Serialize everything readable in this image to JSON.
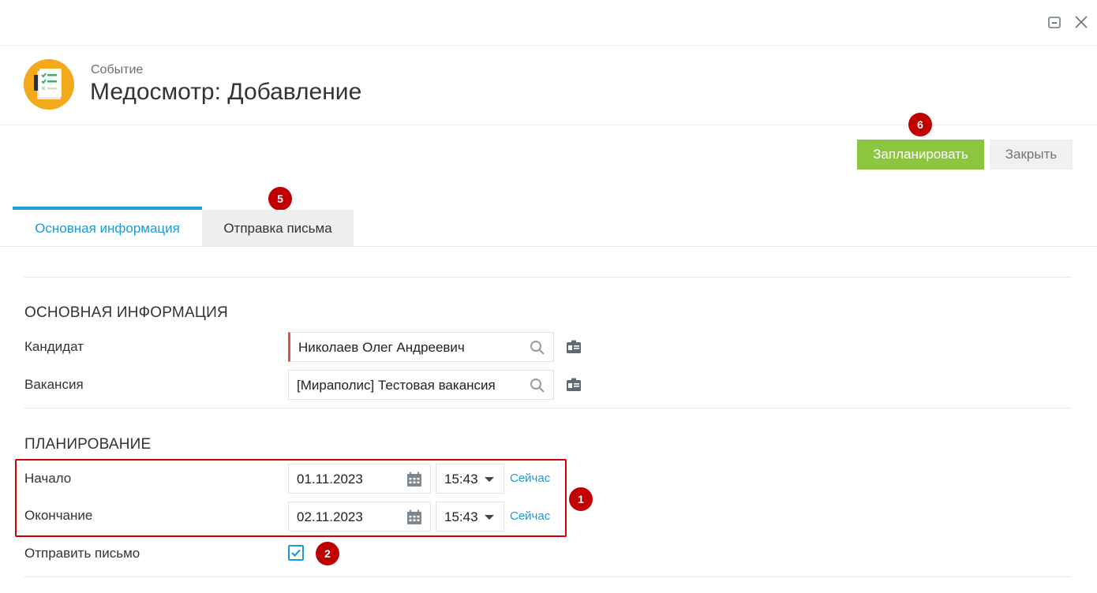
{
  "window": {
    "minimize_icon": "minimize-icon",
    "close_icon": "close-icon"
  },
  "header": {
    "subtitle": "Событие",
    "title": "Медосмотр: Добавление",
    "icon": "checklist-icon"
  },
  "actions": {
    "primary_label": "Запланировать",
    "secondary_label": "Закрыть"
  },
  "tabs": [
    {
      "label": "Основная информация",
      "active": true
    },
    {
      "label": "Отправка письма",
      "active": false
    }
  ],
  "badges": {
    "b1": "1",
    "b2": "2",
    "b5": "5",
    "b6": "6"
  },
  "main_section": {
    "title": "ОСНОВНАЯ ИНФОРМАЦИЯ",
    "candidate_label": "Кандидат",
    "candidate_value": "Николаев Олег Андреевич",
    "vacancy_label": "Вакансия",
    "vacancy_value": "[Мираполис] Тестовая вакансия"
  },
  "planning_section": {
    "title": "ПЛАНИРОВАНИЕ",
    "start_label": "Начало",
    "start_date": "01.11.2023",
    "start_time": "15:43",
    "end_label": "Окончание",
    "end_date": "02.11.2023",
    "end_time": "15:43",
    "now_label": "Сейчас",
    "send_mail_label": "Отправить письмо",
    "send_mail_checked": true
  },
  "colors": {
    "accent": "#1a9bd7",
    "primary_button": "#8cc63f",
    "badge": "#c00000",
    "app_icon_bg": "#f4a81c"
  }
}
